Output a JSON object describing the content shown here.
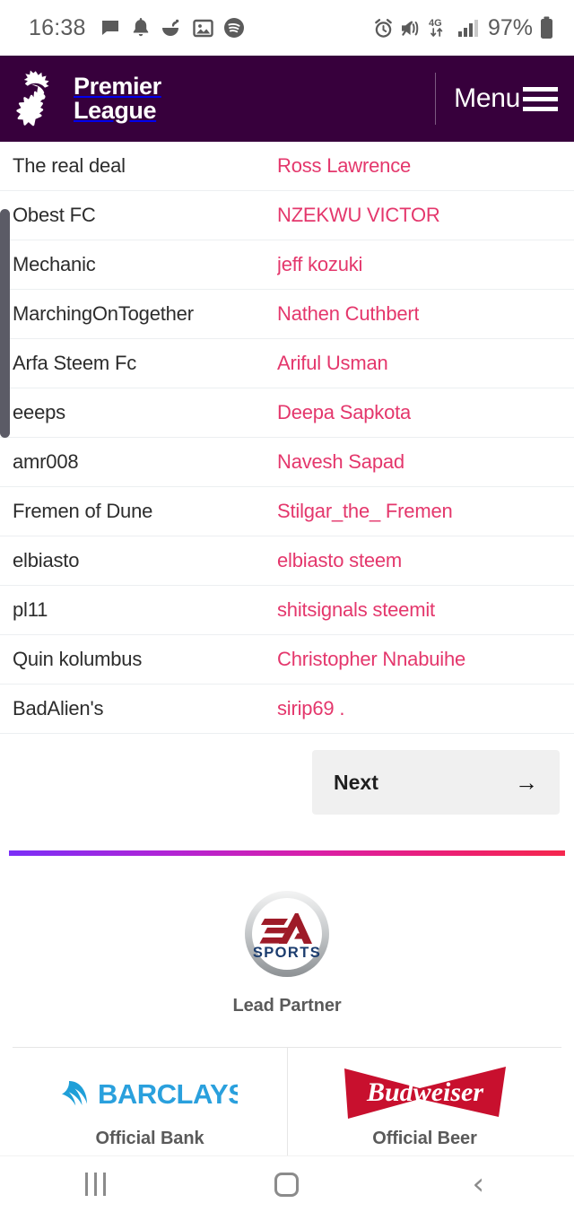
{
  "status_bar": {
    "time": "16:38",
    "battery_percent": "97%",
    "network": "4G",
    "left_icons": [
      "message-icon",
      "bell-icon",
      "food-icon",
      "image-icon",
      "spotify-icon"
    ],
    "right_icons": [
      "alarm-icon",
      "mute-vibrate-icon",
      "4g-data-icon",
      "signal-bars-icon",
      "battery-icon"
    ]
  },
  "header": {
    "brand_line1": "Premier",
    "brand_line2": "League",
    "menu_label": "Menu",
    "background_color": "#37003c"
  },
  "table": {
    "accent_color": "#e4376c",
    "rows": [
      {
        "team": "The real deal",
        "user": "Ross Lawrence"
      },
      {
        "team": "Obest FC",
        "user": "NZEKWU VICTOR"
      },
      {
        "team": "Mechanic",
        "user": "jeff kozuki"
      },
      {
        "team": "MarchingOnTogether",
        "user": "Nathen Cuthbert"
      },
      {
        "team": "Arfa Steem Fc",
        "user": "Ariful Usman"
      },
      {
        "team": "eeeps",
        "user": "Deepa Sapkota"
      },
      {
        "team": "amr008",
        "user": "Navesh Sapad"
      },
      {
        "team": "Fremen of Dune",
        "user": "Stilgar_the_ Fremen"
      },
      {
        "team": "elbiasto",
        "user": "elbiasto steem"
      },
      {
        "team": "pl11",
        "user": "shitsignals steemit"
      },
      {
        "team": "Quin kolumbus",
        "user": "Christopher Nnabuihe"
      },
      {
        "team": "BadAlien's",
        "user": "sirip69 ."
      }
    ]
  },
  "pagination": {
    "next_label": "Next",
    "next_arrow": "→"
  },
  "footer": {
    "lead_partner": {
      "caption": "Lead Partner",
      "logo_name": "ea-sports-logo",
      "logo_text_top": "EA",
      "logo_text_bottom": "SPORTS"
    },
    "partners": [
      {
        "caption": "Official Bank",
        "logo_name": "barclays-logo",
        "logo_text": "BARCLAYS",
        "color": "#2aa0dd"
      },
      {
        "caption": "Official Beer",
        "logo_name": "budweiser-logo",
        "logo_text": "Budweiser",
        "color": "#c8102e"
      }
    ],
    "divider_gradient_from": "#7b2ff7",
    "divider_gradient_to": "#f5274e"
  },
  "nav_bar": {
    "recents_label": "Recents",
    "home_label": "Home",
    "back_label": "Back"
  }
}
